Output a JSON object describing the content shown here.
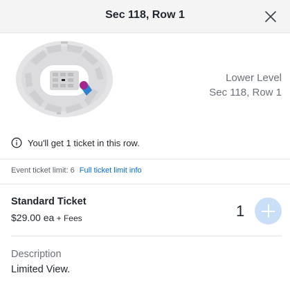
{
  "header": {
    "title": "Sec 118, Row 1",
    "close_icon": "close-icon"
  },
  "seat_map": {
    "highlight_color": "#2f80d1",
    "marker_color": "#a3268f"
  },
  "location": {
    "level": "Lower Level",
    "seat": "Sec 118, Row 1"
  },
  "notice": {
    "icon": "info-icon",
    "text": "You'll get 1 ticket in this row."
  },
  "limit": {
    "text": "Event ticket limit: 6",
    "link": "Full ticket limit info"
  },
  "ticket": {
    "name": "Standard Ticket",
    "price": "$29.00 ea",
    "fees": " + Fees",
    "quantity": "1",
    "add_icon": "plus-icon"
  },
  "description": {
    "label": "Description",
    "text": "Limited View."
  }
}
